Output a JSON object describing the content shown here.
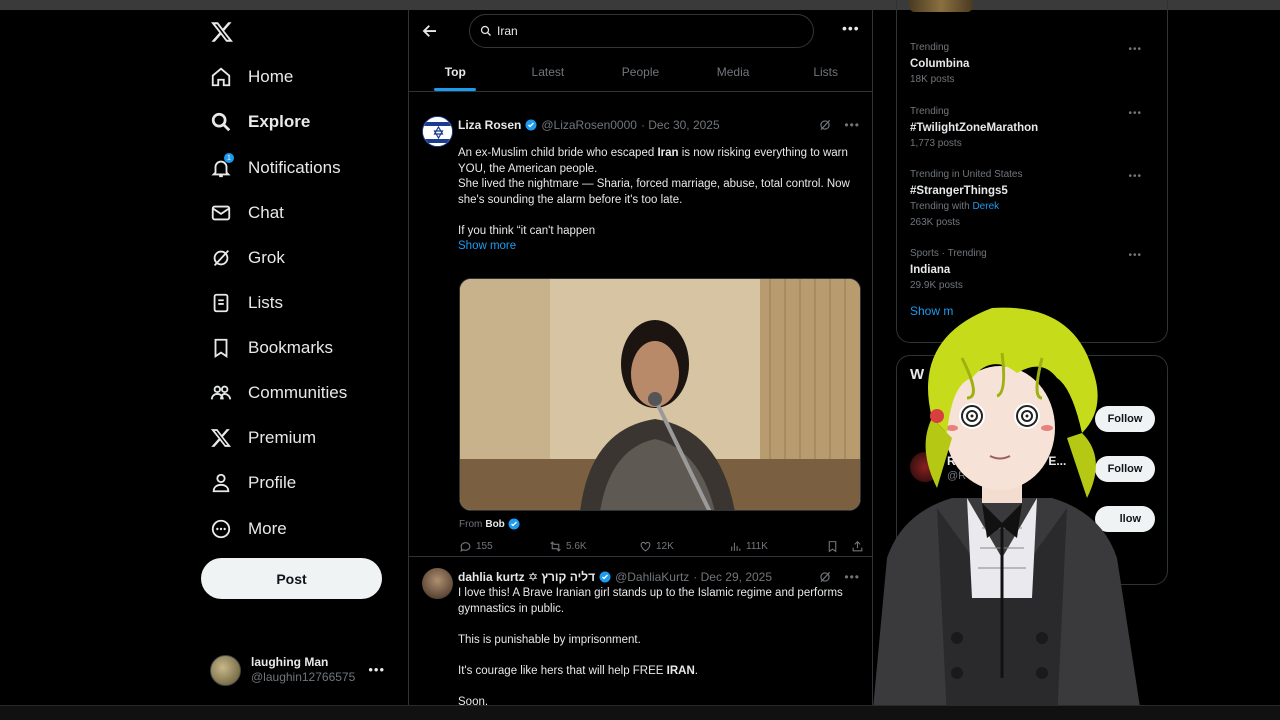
{
  "nav": {
    "items": [
      {
        "label": "Home",
        "icon": "home-icon"
      },
      {
        "label": "Explore",
        "icon": "search-icon"
      },
      {
        "label": "Notifications",
        "icon": "bell-icon",
        "badge": "1"
      },
      {
        "label": "Chat",
        "icon": "mail-icon"
      },
      {
        "label": "Grok",
        "icon": "grok-icon"
      },
      {
        "label": "Lists",
        "icon": "list-icon"
      },
      {
        "label": "Bookmarks",
        "icon": "bookmark-icon"
      },
      {
        "label": "Communities",
        "icon": "communities-icon"
      },
      {
        "label": "Premium",
        "icon": "x-logo-icon"
      },
      {
        "label": "Profile",
        "icon": "person-icon"
      },
      {
        "label": "More",
        "icon": "more-circle-icon"
      }
    ],
    "post_label": "Post",
    "account": {
      "name": "laughing Man",
      "handle": "@laughin12766575"
    }
  },
  "search": {
    "query": "Iran"
  },
  "tabs": [
    "Top",
    "Latest",
    "People",
    "Media",
    "Lists"
  ],
  "tweets": [
    {
      "name": "Liza Rosen",
      "handle": "@LizaRosen0000",
      "date": "· Dec 30, 2025",
      "body": [
        {
          "pre": "An ex-Muslim child bride who escaped ",
          "bold": "Iran",
          "post": " is now risking everything to warn YOU, the American people."
        },
        {
          "text": "She lived the nightmare — Sharia, forced marriage, abuse, total control. Now she's sounding the alarm before it's too late."
        },
        {
          "text": "If you think “it can't happen"
        }
      ],
      "show_more": "Show more",
      "from_prefix": "From",
      "from_name": "Bob",
      "stats": {
        "replies": "155",
        "reposts": "5.6K",
        "likes": "12K",
        "views": "111K"
      }
    },
    {
      "name": "dahlia kurtz ✡ דליה קורץ",
      "handle": "@DahliaKurtz",
      "date": "· Dec 29, 2025",
      "body": [
        {
          "text": "I love this! A Brave Iranian girl stands up to the Islamic regime and performs gymnastics in public."
        },
        {
          "text": "This is punishable by imprisonment."
        },
        {
          "pre": "It's courage like hers that will help FREE ",
          "bold": "IRAN",
          "post": "."
        },
        {
          "text": "Soon."
        }
      ]
    }
  ],
  "trends": [
    {
      "category": "Trending",
      "title": "Columbina",
      "count": "18K posts"
    },
    {
      "category": "Trending",
      "title": "#TwilightZoneMarathon",
      "count": "1,773 posts"
    },
    {
      "category": "Trending in United States",
      "title": "#StrangerThings5",
      "with_prefix": "Trending with",
      "with_link": "Derek",
      "count": "263K posts"
    },
    {
      "category": "Sports · Trending",
      "title": "Indiana",
      "count": "29.9K posts"
    }
  ],
  "trends_show_more": "Show m",
  "who_to_follow": {
    "title": "W",
    "follow_label": "Follow",
    "second_name": "Re",
    "second_name_tail": "E...",
    "second_handle": "@R",
    "third_follow_partial": "llow"
  },
  "colors": {
    "accent": "#1d9bf0",
    "bg": "#000000",
    "text": "#e7e9ea",
    "muted": "#71767b",
    "border": "#2f3336"
  }
}
